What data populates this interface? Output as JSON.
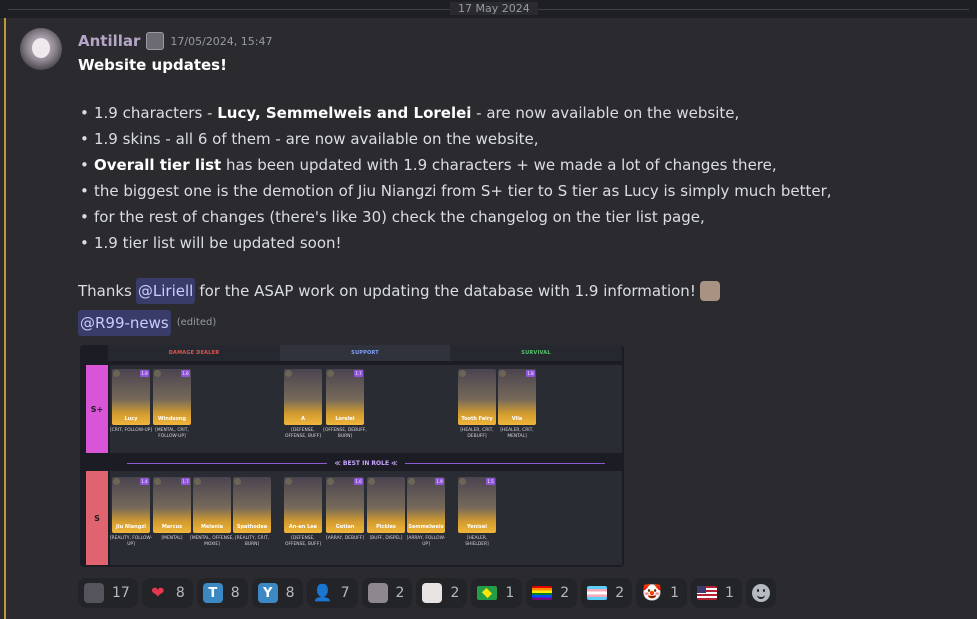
{
  "date_divider": "17 May 2024",
  "message": {
    "author": "Antillar",
    "timestamp": "17/05/2024, 15:47",
    "title": "Website updates!",
    "bullets": [
      {
        "pre": "1.9 characters - ",
        "bold": "Lucy, Semmelweis and Lorelei",
        "post": " - are now available on the website,"
      },
      {
        "pre": "1.9 skins - all 6 of them - are now available on the website,",
        "bold": "",
        "post": ""
      },
      {
        "pre": "",
        "bold": "Overall tier list",
        "post": " has been updated with 1.9 characters + we made a lot of changes there,"
      },
      {
        "pre": "the biggest one is the demotion of Jiu Niangzi from S+ tier to S tier as Lucy is simply much better,",
        "bold": "",
        "post": ""
      },
      {
        "pre": "for the rest of changes (there's like 30) check the changelog on the tier list page,",
        "bold": "",
        "post": ""
      },
      {
        "pre": "1.9 tier list will be updated soon!",
        "bold": "",
        "post": ""
      }
    ],
    "thanks": {
      "pre": "Thanks",
      "mention": "@Liriell",
      "post": "for the ASAP work on updating the database with 1.9 information!"
    },
    "channel_mention": "@R99-news",
    "edited": "(edited)"
  },
  "tier_list": {
    "columns": [
      {
        "label": "DAMAGE DEALER",
        "color": "#e0564e"
      },
      {
        "label": "SUPPORT",
        "color": "#7fa3ff"
      },
      {
        "label": "SURVIVAL",
        "color": "#56c46a"
      }
    ],
    "tiers": [
      {
        "label": "S+",
        "color": "#d855d8"
      },
      {
        "label": "S",
        "color": "#e06470"
      }
    ],
    "best_in_role": "≪ BEST IN ROLE ≪",
    "splus": [
      {
        "name": "Lucy",
        "lvl": "1.9",
        "tags": "[CRIT, FOLLOW-UP]"
      },
      {
        "name": "Windsong",
        "lvl": "1.6",
        "tags": "[MENTAL, CRIT, FOLLOW-UP]"
      },
      {
        "name": "A",
        "lvl": "",
        "tags": "[DEFENSE, OFFENSE, BUFF]"
      },
      {
        "name": "Lorelei",
        "lvl": "1.7",
        "tags": "[OFFENSE, DEBUFF, BURN]"
      },
      {
        "name": "Tooth Fairy",
        "lvl": "",
        "tags": "[HEALER, CRIT, DEBUFF]"
      },
      {
        "name": "Vila",
        "lvl": "1.8",
        "tags": "[HEALER, CRIT, MENTAL]"
      }
    ],
    "s": [
      {
        "name": "Jiu Niangzi",
        "lvl": "1.4",
        "tags": "[REALITY, FOLLOW-UP]"
      },
      {
        "name": "Marcus",
        "lvl": "1.7",
        "tags": "[MENTAL]"
      },
      {
        "name": "Melania",
        "lvl": "",
        "tags": "[MENTAL, OFFENSE, MOXIE]"
      },
      {
        "name": "Spathodea",
        "lvl": "",
        "tags": "[REALITY, CRIT, BURN]"
      },
      {
        "name": "An-an Lee",
        "lvl": "",
        "tags": "[DEFENSE, OFFENSE, BUFF]"
      },
      {
        "name": "Getian",
        "lvl": "1.6",
        "tags": "[ARRAY, DEBUFF]"
      },
      {
        "name": "Pickles",
        "lvl": "",
        "tags": "[BUFF, DISPEL]"
      },
      {
        "name": "Semmelweis",
        "lvl": "1.9",
        "tags": "[ARRAY, FOLLOW-UP]"
      },
      {
        "name": "Yenisei",
        "lvl": "1.5",
        "tags": "[HEALER, SHIELDER]"
      }
    ]
  },
  "reactions": [
    {
      "icon": "custom-emote-icon",
      "glyph": "",
      "count": "17"
    },
    {
      "icon": "heart-icon",
      "glyph": "❤",
      "count": "8"
    },
    {
      "icon": "letter-t-icon",
      "glyph": "T",
      "count": "8"
    },
    {
      "icon": "letter-y-icon",
      "glyph": "Y",
      "count": "8"
    },
    {
      "icon": "person-icon",
      "glyph": "👤",
      "count": "7"
    },
    {
      "icon": "chibi-emote-icon",
      "glyph": "",
      "count": "2"
    },
    {
      "icon": "bunny-emote-icon",
      "glyph": "",
      "count": "2"
    },
    {
      "icon": "brazil-flag-icon",
      "glyph": "",
      "count": "1"
    },
    {
      "icon": "rainbow-flag-icon",
      "glyph": "",
      "count": "2"
    },
    {
      "icon": "trans-flag-icon",
      "glyph": "",
      "count": "2"
    },
    {
      "icon": "clown-icon",
      "glyph": "🤡",
      "count": "1"
    },
    {
      "icon": "us-flag-icon",
      "glyph": "",
      "count": "1"
    }
  ],
  "colors": {
    "accent_bar": "#c09a37",
    "mention_bg": "#3c4270",
    "mention_text": "#c9cdfb",
    "username": "#b5a6c9"
  }
}
